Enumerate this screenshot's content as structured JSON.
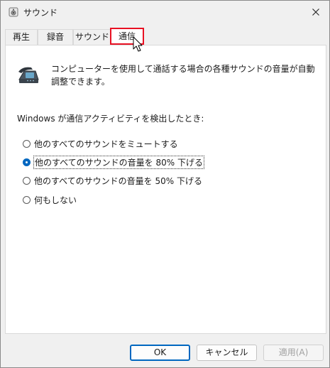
{
  "window": {
    "title": "サウンド",
    "close_icon": "close-icon",
    "app_icon": "speaker-icon"
  },
  "tabs": [
    {
      "label": "再生",
      "active": false
    },
    {
      "label": "録音",
      "active": false
    },
    {
      "label": "サウンド",
      "active": false
    },
    {
      "label": "通信",
      "active": true
    }
  ],
  "highlight_color": "#e81123",
  "accent_color": "#0067c0",
  "communications": {
    "icon": "telephone-icon",
    "description": "コンピューターを使用して通話する場合の各種サウンドの音量が自動調整できます。",
    "prompt": "Windows が通信アクティビティを検出したとき:",
    "options": [
      {
        "label": "他のすべてのサウンドをミュートする",
        "selected": false
      },
      {
        "label": "他のすべてのサウンドの音量を 80% 下げる",
        "selected": true
      },
      {
        "label": "他のすべてのサウンドの音量を 50% 下げる",
        "selected": false
      },
      {
        "label": "何もしない",
        "selected": false
      }
    ]
  },
  "buttons": {
    "ok": "OK",
    "cancel": "キャンセル",
    "apply": "適用(A)"
  }
}
